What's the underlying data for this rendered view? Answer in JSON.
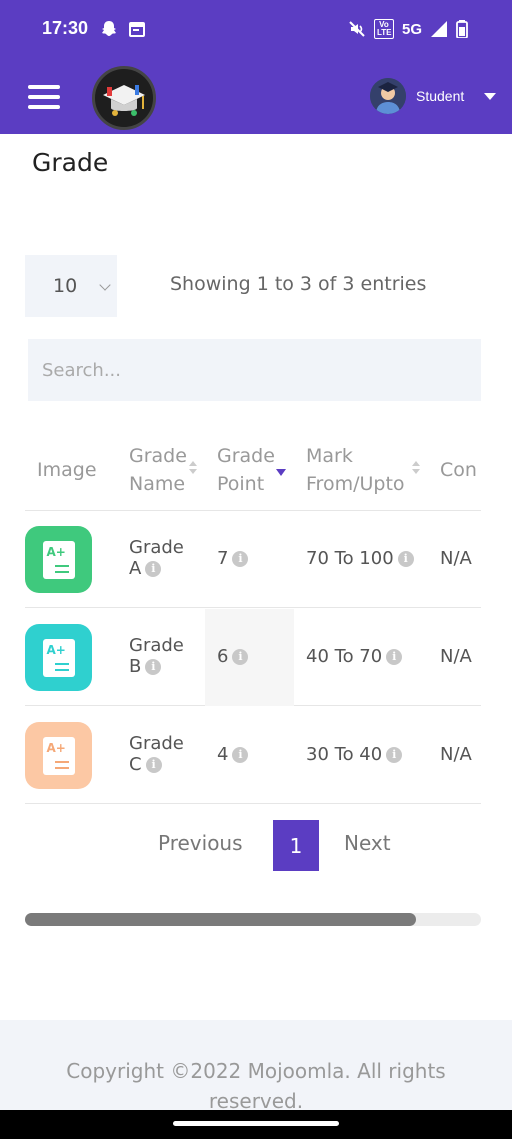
{
  "status_bar": {
    "time": "17:30",
    "network": "5G",
    "volte": "Vo LTE"
  },
  "header": {
    "menu_icon": "hamburger-icon",
    "user_name": "Student"
  },
  "page": {
    "title": "Grade"
  },
  "table_controls": {
    "page_length": "10",
    "info": "Showing 1 to 3 of 3 entries",
    "search_placeholder": "Search..."
  },
  "table": {
    "columns": [
      {
        "line1": "Image",
        "line2": ""
      },
      {
        "line1": "Grade",
        "line2": "Name"
      },
      {
        "line1": "Grade",
        "line2": "Point"
      },
      {
        "line1": "Mark",
        "line2": "From/Upto"
      },
      {
        "line1": "Con",
        "line2": ""
      }
    ],
    "rows": [
      {
        "name_line1": "Grade",
        "name_line2": "A",
        "point": "7",
        "marks": "70 To 100",
        "comment": "N/A",
        "color": "#3fc97d"
      },
      {
        "name_line1": "Grade",
        "name_line2": "B",
        "point": "6",
        "marks": "40 To 70",
        "comment": "N/A",
        "color": "#2fd0cf"
      },
      {
        "name_line1": "Grade",
        "name_line2": "C",
        "point": "4",
        "marks": "30 To 40",
        "comment": "N/A",
        "color": "#fcc8a4"
      }
    ]
  },
  "pagination": {
    "previous": "Previous",
    "current": "1",
    "next": "Next"
  },
  "scroll": {
    "horizontal_position_fraction": 0.86
  },
  "footer": {
    "copyright": "Copyright ©2022 Mojoomla. All rights reserved."
  },
  "colors": {
    "primary": "#5b3dc2",
    "input_bg": "#f1f4f9"
  }
}
